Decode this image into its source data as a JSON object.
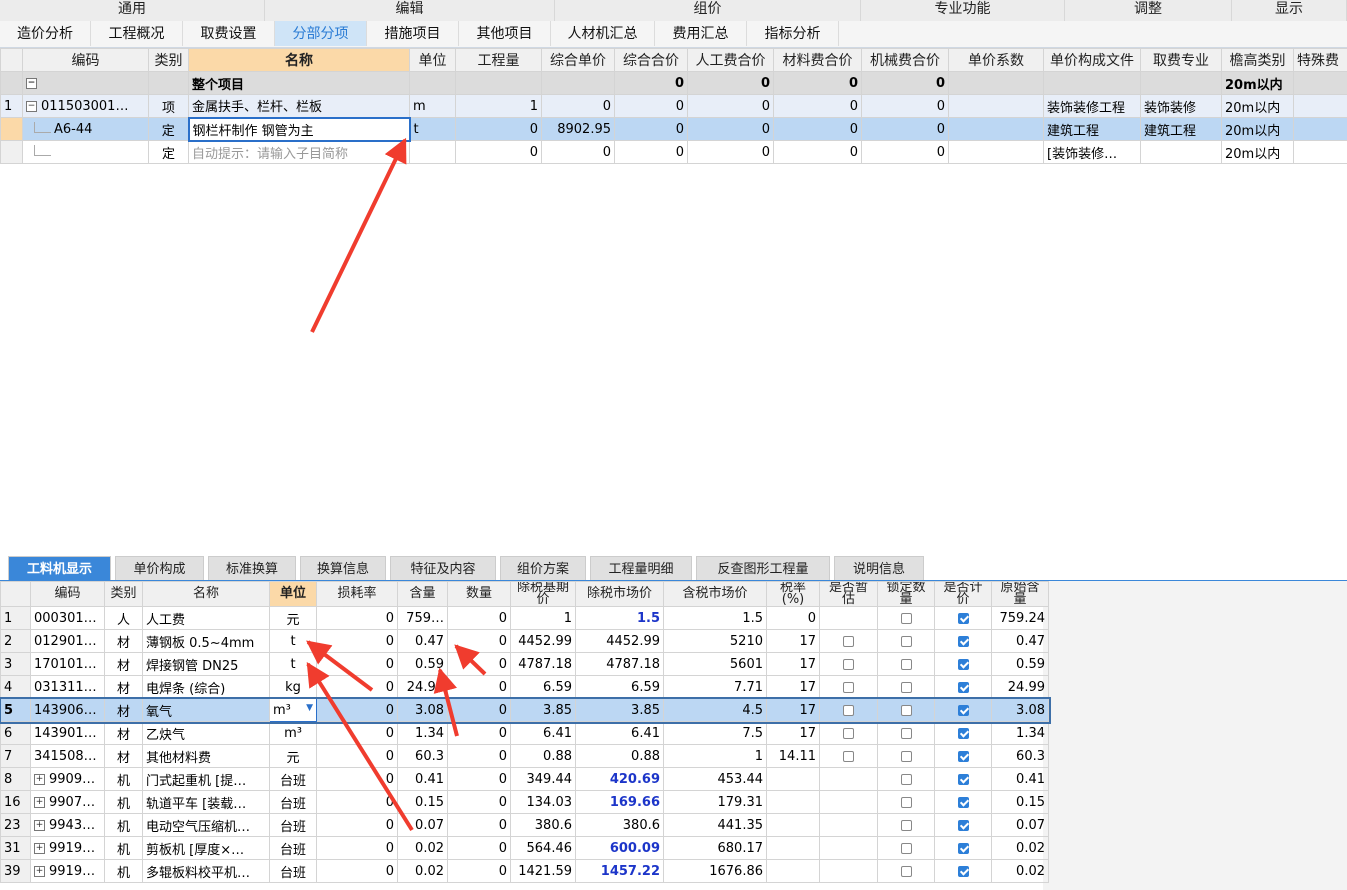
{
  "menu": [
    "通用",
    "编辑",
    "组价",
    "专业功能",
    "调整",
    "显示"
  ],
  "top_tabs": [
    {
      "label": "造价分析",
      "active": false
    },
    {
      "label": "工程概况",
      "active": false
    },
    {
      "label": "取费设置",
      "active": false
    },
    {
      "label": "分部分项",
      "active": true
    },
    {
      "label": "措施项目",
      "active": false
    },
    {
      "label": "其他项目",
      "active": false
    },
    {
      "label": "人材机汇总",
      "active": false
    },
    {
      "label": "费用汇总",
      "active": false
    },
    {
      "label": "指标分析",
      "active": false
    }
  ],
  "top_table": {
    "headers": [
      "编码",
      "类别",
      "名称",
      "单位",
      "工程量",
      "综合单价",
      "综合合价",
      "人工费合价",
      "材料费合价",
      "机械费合价",
      "单价系数",
      "单价构成文件",
      "取费专业",
      "檐高类别",
      "特殊费"
    ],
    "summary": {
      "label": "整个项目",
      "zonghe_heji": "0",
      "rengong": "0",
      "cailiao": "0",
      "jixie": "0",
      "yangao": "20m以内"
    },
    "rows": [
      {
        "rn": "1",
        "code": "011503001…",
        "type": "项",
        "name": "金属扶手、栏杆、栏板",
        "unit": "m",
        "qty": "1",
        "uprice": "0",
        "total": "0",
        "labor": "0",
        "mat": "0",
        "mach": "0",
        "coef": "",
        "file": "装饰装修工程",
        "spec": "装饰装修",
        "height": "20m以内"
      },
      {
        "rn": "",
        "code": "A6-44",
        "type": "定",
        "name": "钢栏杆制作 钢管为主",
        "unit": "t",
        "qty": "0",
        "uprice": "8902.95",
        "total": "0",
        "labor": "0",
        "mat": "0",
        "mach": "0",
        "coef": "",
        "file": "建筑工程",
        "spec": "建筑工程",
        "height": "20m以内"
      },
      {
        "rn": "",
        "code": "",
        "type": "定",
        "name": "自动提示：请输入子目简称",
        "unit": "",
        "qty": "0",
        "uprice": "0",
        "total": "0",
        "labor": "0",
        "mat": "0",
        "mach": "0",
        "coef": "",
        "file": "[装饰装修…",
        "spec": "",
        "height": "20m以内"
      }
    ]
  },
  "bottom_tabs": [
    "工料机显示",
    "单价构成",
    "标准换算",
    "换算信息",
    "特征及内容",
    "组价方案",
    "工程量明细",
    "反查图形工程量",
    "说明信息"
  ],
  "bottom_table": {
    "headers": [
      "",
      "编码",
      "类别",
      "名称",
      "单位",
      "损耗率",
      "含量",
      "数量",
      "除税基期价",
      "除税市场价",
      "含税市场价",
      "税率(%)",
      "是否暂估",
      "锁定数量",
      "是否计价",
      "原始含量"
    ],
    "rows": [
      {
        "rn": "1",
        "exp": false,
        "code": "000301…",
        "type": "人",
        "name": "人工费",
        "unit": "元",
        "loss": "0",
        "content": "759…",
        "qty": "0",
        "base": "1",
        "market": "1.5",
        "market_blue": true,
        "tax_market": "1.5",
        "rate": "0",
        "zangu": null,
        "lock": false,
        "jijia": true,
        "orig": "759.24"
      },
      {
        "rn": "2",
        "exp": false,
        "code": "012901…",
        "type": "材",
        "name": "薄钢板 0.5~4mm",
        "unit": "t",
        "loss": "0",
        "content": "0.47",
        "qty": "0",
        "base": "4452.99",
        "market": "4452.99",
        "market_blue": false,
        "tax_market": "5210",
        "rate": "17",
        "zangu": false,
        "lock": false,
        "jijia": true,
        "orig": "0.47"
      },
      {
        "rn": "3",
        "exp": false,
        "code": "170101…",
        "type": "材",
        "name": "焊接钢管 DN25",
        "unit": "t",
        "loss": "0",
        "content": "0.59",
        "qty": "0",
        "base": "4787.18",
        "market": "4787.18",
        "market_blue": false,
        "tax_market": "5601",
        "rate": "17",
        "zangu": false,
        "lock": false,
        "jijia": true,
        "orig": "0.59"
      },
      {
        "rn": "4",
        "exp": false,
        "code": "031311…",
        "type": "材",
        "name": "电焊条 (综合)",
        "unit": "kg",
        "loss": "0",
        "content": "24.99",
        "qty": "0",
        "base": "6.59",
        "market": "6.59",
        "market_blue": false,
        "tax_market": "7.71",
        "rate": "17",
        "zangu": false,
        "lock": false,
        "jijia": true,
        "orig": "24.99"
      },
      {
        "rn": "5",
        "exp": false,
        "code": "143906…",
        "type": "材",
        "name": "氧气",
        "unit": "m³",
        "loss": "0",
        "content": "3.08",
        "qty": "0",
        "base": "3.85",
        "market": "3.85",
        "market_blue": false,
        "tax_market": "4.5",
        "rate": "17",
        "zangu": false,
        "lock": false,
        "jijia": true,
        "orig": "3.08"
      },
      {
        "rn": "6",
        "exp": false,
        "code": "143901…",
        "type": "材",
        "name": "乙炔气",
        "unit": "m³",
        "loss": "0",
        "content": "1.34",
        "qty": "0",
        "base": "6.41",
        "market": "6.41",
        "market_blue": false,
        "tax_market": "7.5",
        "rate": "17",
        "zangu": false,
        "lock": false,
        "jijia": true,
        "orig": "1.34"
      },
      {
        "rn": "7",
        "exp": false,
        "code": "341508…",
        "type": "材",
        "name": "其他材料费",
        "unit": "元",
        "loss": "0",
        "content": "60.3",
        "qty": "0",
        "base": "0.88",
        "market": "0.88",
        "market_blue": false,
        "tax_market": "1",
        "rate": "14.11",
        "zangu": false,
        "lock": false,
        "jijia": true,
        "orig": "60.3"
      },
      {
        "rn": "8",
        "exp": true,
        "code": "9909…",
        "type": "机",
        "name": "门式起重机 [提…",
        "unit": "台班",
        "loss": "0",
        "content": "0.41",
        "qty": "0",
        "base": "349.44",
        "market": "420.69",
        "market_blue": true,
        "tax_market": "453.44",
        "rate": "",
        "zangu": null,
        "lock": false,
        "jijia": true,
        "orig": "0.41"
      },
      {
        "rn": "16",
        "exp": true,
        "code": "9907…",
        "type": "机",
        "name": "轨道平车 [装载…",
        "unit": "台班",
        "loss": "0",
        "content": "0.15",
        "qty": "0",
        "base": "134.03",
        "market": "169.66",
        "market_blue": true,
        "tax_market": "179.31",
        "rate": "",
        "zangu": null,
        "lock": false,
        "jijia": true,
        "orig": "0.15"
      },
      {
        "rn": "23",
        "exp": true,
        "code": "9943…",
        "type": "机",
        "name": "电动空气压缩机…",
        "unit": "台班",
        "loss": "0",
        "content": "0.07",
        "qty": "0",
        "base": "380.6",
        "market": "380.6",
        "market_blue": false,
        "tax_market": "441.35",
        "rate": "",
        "zangu": null,
        "lock": false,
        "jijia": true,
        "orig": "0.07"
      },
      {
        "rn": "31",
        "exp": true,
        "code": "9919…",
        "type": "机",
        "name": "剪板机 [厚度×…",
        "unit": "台班",
        "loss": "0",
        "content": "0.02",
        "qty": "0",
        "base": "564.46",
        "market": "600.09",
        "market_blue": true,
        "tax_market": "680.17",
        "rate": "",
        "zangu": null,
        "lock": false,
        "jijia": true,
        "orig": "0.02"
      },
      {
        "rn": "39",
        "exp": true,
        "code": "9919…",
        "type": "机",
        "name": "多辊板料校平机…",
        "unit": "台班",
        "loss": "0",
        "content": "0.02",
        "qty": "0",
        "base": "1421.59",
        "market": "1457.22",
        "market_blue": true,
        "tax_market": "1676.86",
        "rate": "",
        "zangu": null,
        "lock": false,
        "jijia": true,
        "orig": "0.02"
      }
    ]
  },
  "colors": {
    "accent": "#3a87d9",
    "arrow": "#f03c2e",
    "selected_row": "#bcd7f3",
    "header_highlight": "#fbd9a8",
    "blue_price": "#1c35c9"
  },
  "icons": {
    "expander": "plus-minus-box",
    "dropdown": "triangle-down",
    "checkbox": "checkbox"
  }
}
